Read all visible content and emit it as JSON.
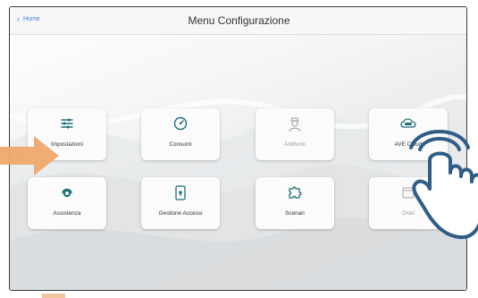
{
  "header": {
    "back_label": "Home",
    "title": "Menu Configurazione"
  },
  "tiles": [
    {
      "label": "Impostazioni",
      "icon": "settings-sliders-icon",
      "enabled": true
    },
    {
      "label": "Consumi",
      "icon": "gauge-icon",
      "enabled": true
    },
    {
      "label": "Antifurto",
      "icon": "security-guard-icon",
      "enabled": false
    },
    {
      "label": "AVE Cloud",
      "icon": "ave-cloud-icon",
      "enabled": true
    },
    {
      "label": "Assistenza",
      "icon": "headset-icon",
      "enabled": true
    },
    {
      "label": "Gestione Accessi",
      "icon": "access-phone-icon",
      "enabled": true
    },
    {
      "label": "Scenari",
      "icon": "puzzle-icon",
      "enabled": true
    },
    {
      "label": "Orari",
      "icon": "calendar-icon",
      "enabled": false
    }
  ],
  "colors": {
    "accent": "#3f7fd9",
    "icon_teal": "#1d6f78",
    "arrow": "#f0a86c",
    "hand": "#2f5d86"
  }
}
